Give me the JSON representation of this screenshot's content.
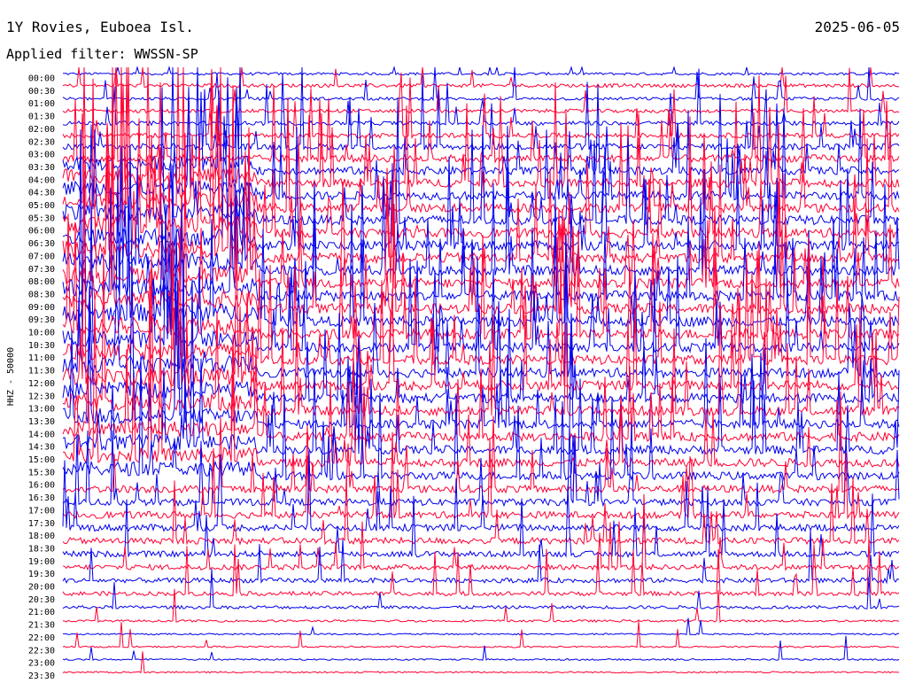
{
  "header": {
    "station": "1Y Rovies, Euboea Isl.",
    "date": "2025-06-05",
    "filter": "Applied filter: WWSSN-SP"
  },
  "chart_data": {
    "type": "line",
    "title": "1Y Rovies, Euboea Isl.",
    "ylabel": "HHZ - 50000",
    "xlabel": "",
    "grid": false,
    "row_labels": [
      "00:00",
      "00:30",
      "01:00",
      "01:30",
      "02:00",
      "02:30",
      "03:00",
      "03:30",
      "04:00",
      "04:30",
      "05:00",
      "05:30",
      "06:00",
      "06:30",
      "07:00",
      "07:30",
      "08:00",
      "08:30",
      "09:00",
      "09:30",
      "10:00",
      "10:30",
      "11:00",
      "11:30",
      "12:00",
      "12:30",
      "13:00",
      "13:30",
      "14:00",
      "14:30",
      "15:00",
      "15:30",
      "16:00",
      "16:30",
      "17:00",
      "17:30",
      "18:00",
      "18:30",
      "19:00",
      "19:30",
      "20:00",
      "20:30",
      "21:00",
      "21:30",
      "22:00",
      "22:30",
      "23:00",
      "23:30"
    ],
    "row_minutes": 30,
    "series_colors": [
      "#0000ee",
      "#ff0033"
    ],
    "relative_activity_by_row": [
      0.5,
      0.7,
      0.6,
      0.7,
      0.8,
      0.9,
      1.2,
      1.4,
      1.5,
      1.6,
      1.6,
      1.7,
      1.8,
      1.8,
      1.8,
      1.9,
      1.9,
      1.9,
      1.9,
      1.9,
      1.9,
      1.9,
      1.8,
      1.8,
      1.8,
      1.8,
      1.8,
      1.8,
      1.7,
      1.7,
      1.6,
      1.6,
      1.5,
      1.4,
      1.3,
      1.3,
      1.3,
      1.2,
      1.1,
      1.0,
      0.9,
      0.8,
      0.6,
      0.4,
      0.3,
      0.3,
      0.3,
      0.3
    ]
  }
}
